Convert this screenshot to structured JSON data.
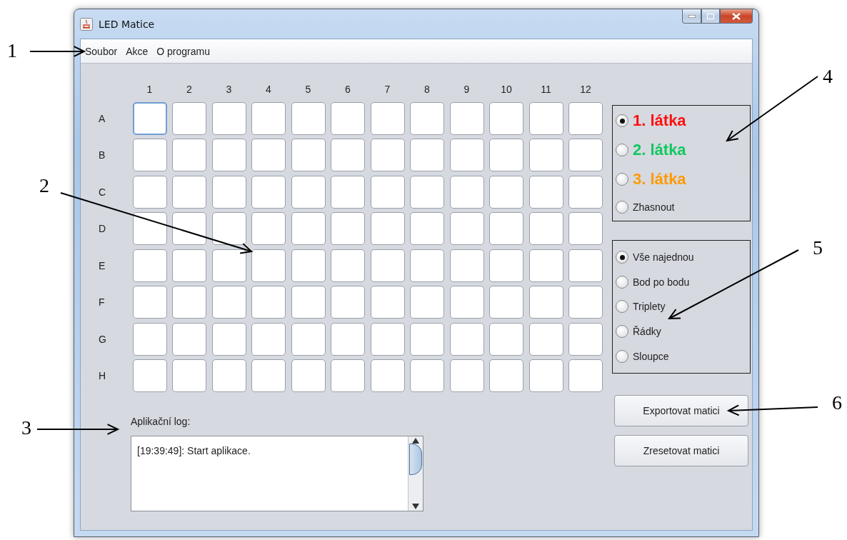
{
  "window": {
    "title": "LED Matice"
  },
  "menu": [
    {
      "label": "Soubor"
    },
    {
      "label": "Akce"
    },
    {
      "label": "O programu"
    }
  ],
  "matrix": {
    "columns": [
      "1",
      "2",
      "3",
      "4",
      "5",
      "6",
      "7",
      "8",
      "9",
      "10",
      "11",
      "12"
    ],
    "rows": [
      {
        "label": "A",
        "cells": [
          {
            "focused": true
          },
          {
            "focused": false
          },
          {
            "focused": false
          },
          {
            "focused": false
          },
          {
            "focused": false
          },
          {
            "focused": false
          },
          {
            "focused": false
          },
          {
            "focused": false
          },
          {
            "focused": false
          },
          {
            "focused": false
          },
          {
            "focused": false
          },
          {
            "focused": false
          }
        ]
      },
      {
        "label": "B",
        "cells": [
          {
            "focused": false
          },
          {
            "focused": false
          },
          {
            "focused": false
          },
          {
            "focused": false
          },
          {
            "focused": false
          },
          {
            "focused": false
          },
          {
            "focused": false
          },
          {
            "focused": false
          },
          {
            "focused": false
          },
          {
            "focused": false
          },
          {
            "focused": false
          },
          {
            "focused": false
          }
        ]
      },
      {
        "label": "C",
        "cells": [
          {
            "focused": false
          },
          {
            "focused": false
          },
          {
            "focused": false
          },
          {
            "focused": false
          },
          {
            "focused": false
          },
          {
            "focused": false
          },
          {
            "focused": false
          },
          {
            "focused": false
          },
          {
            "focused": false
          },
          {
            "focused": false
          },
          {
            "focused": false
          },
          {
            "focused": false
          }
        ]
      },
      {
        "label": "D",
        "cells": [
          {
            "focused": false
          },
          {
            "focused": false
          },
          {
            "focused": false
          },
          {
            "focused": false
          },
          {
            "focused": false
          },
          {
            "focused": false
          },
          {
            "focused": false
          },
          {
            "focused": false
          },
          {
            "focused": false
          },
          {
            "focused": false
          },
          {
            "focused": false
          },
          {
            "focused": false
          }
        ]
      },
      {
        "label": "E",
        "cells": [
          {
            "focused": false
          },
          {
            "focused": false
          },
          {
            "focused": false
          },
          {
            "focused": false
          },
          {
            "focused": false
          },
          {
            "focused": false
          },
          {
            "focused": false
          },
          {
            "focused": false
          },
          {
            "focused": false
          },
          {
            "focused": false
          },
          {
            "focused": false
          },
          {
            "focused": false
          }
        ]
      },
      {
        "label": "F",
        "cells": [
          {
            "focused": false
          },
          {
            "focused": false
          },
          {
            "focused": false
          },
          {
            "focused": false
          },
          {
            "focused": false
          },
          {
            "focused": false
          },
          {
            "focused": false
          },
          {
            "focused": false
          },
          {
            "focused": false
          },
          {
            "focused": false
          },
          {
            "focused": false
          },
          {
            "focused": false
          }
        ]
      },
      {
        "label": "G",
        "cells": [
          {
            "focused": false
          },
          {
            "focused": false
          },
          {
            "focused": false
          },
          {
            "focused": false
          },
          {
            "focused": false
          },
          {
            "focused": false
          },
          {
            "focused": false
          },
          {
            "focused": false
          },
          {
            "focused": false
          },
          {
            "focused": false
          },
          {
            "focused": false
          },
          {
            "focused": false
          }
        ]
      },
      {
        "label": "H",
        "cells": [
          {
            "focused": false
          },
          {
            "focused": false
          },
          {
            "focused": false
          },
          {
            "focused": false
          },
          {
            "focused": false
          },
          {
            "focused": false
          },
          {
            "focused": false
          },
          {
            "focused": false
          },
          {
            "focused": false
          },
          {
            "focused": false
          },
          {
            "focused": false
          },
          {
            "focused": false
          }
        ]
      }
    ]
  },
  "substances": [
    {
      "label": "1. látka",
      "selected": true,
      "color": "#ff1010"
    },
    {
      "label": "2. látka",
      "selected": false,
      "color": "#10c860"
    },
    {
      "label": "3. látka",
      "selected": false,
      "color": "#ff9a00"
    },
    {
      "label": "Zhasnout",
      "selected": false
    }
  ],
  "modes": [
    {
      "label": "Vše najednou",
      "selected": true
    },
    {
      "label": "Bod po bodu",
      "selected": false
    },
    {
      "label": "Triplety",
      "selected": false
    },
    {
      "label": "Řádky",
      "selected": false
    },
    {
      "label": "Sloupce",
      "selected": false
    }
  ],
  "buttons": [
    "Exportovat matici",
    "Zresetovat matici"
  ],
  "log": {
    "label": "Aplikační log:",
    "lines": [
      "[19:39:49]: Start aplikace."
    ]
  },
  "annotations": [
    {
      "label": "1"
    },
    {
      "label": "2"
    },
    {
      "label": "3"
    },
    {
      "label": "4"
    },
    {
      "label": "5"
    },
    {
      "label": "6"
    }
  ]
}
